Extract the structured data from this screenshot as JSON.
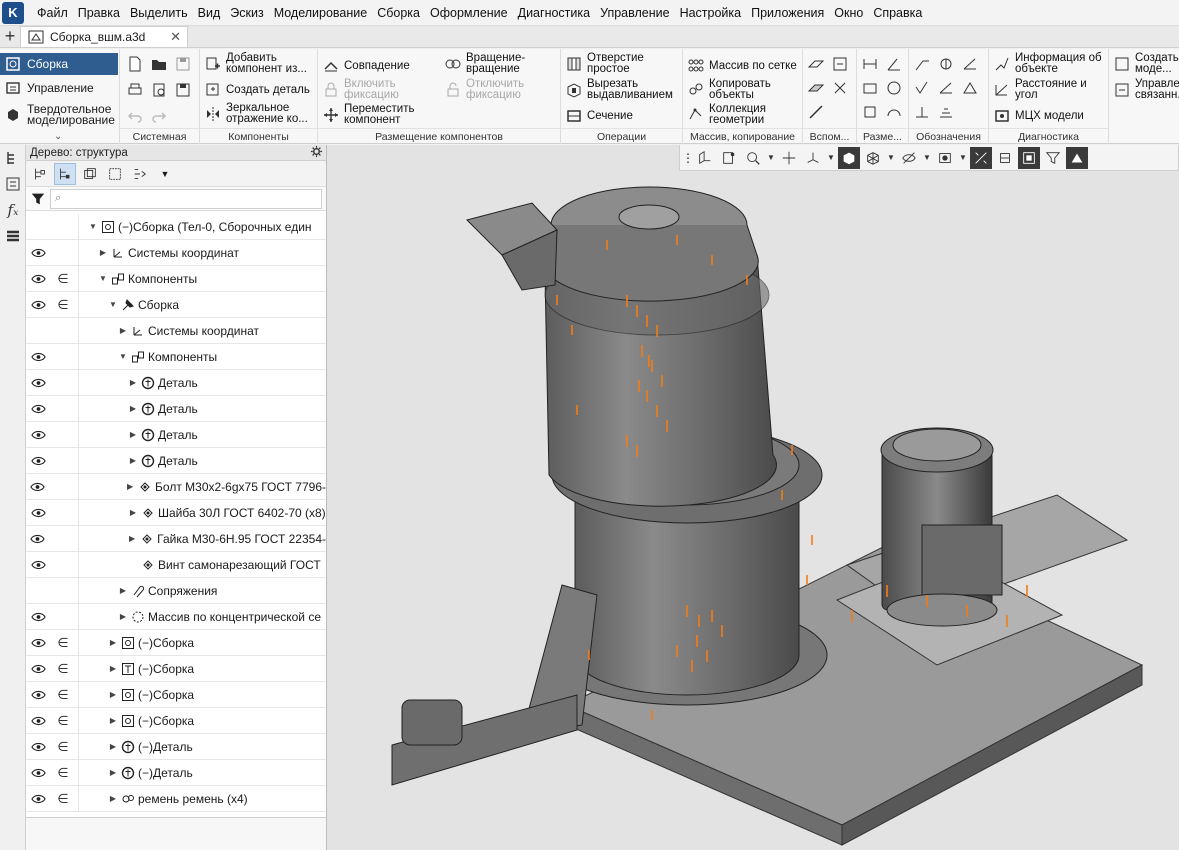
{
  "menu": {
    "items": [
      "Файл",
      "Правка",
      "Выделить",
      "Вид",
      "Эскиз",
      "Моделирование",
      "Сборка",
      "Оформление",
      "Диагностика",
      "Управление",
      "Настройка",
      "Приложения",
      "Окно",
      "Справка"
    ]
  },
  "tabs": {
    "doc_title": "Сборка_вшм.a3d"
  },
  "ribbon": {
    "modes": [
      "Сборка",
      "Управление",
      "Твердотельное моделирование"
    ],
    "groups": {
      "system": "Системная",
      "components": "Компоненты",
      "placement": "Размещение компонентов",
      "operations": "Операции",
      "array": "Массив, копирование",
      "aux": "Вспом...",
      "dims": "Разме...",
      "notation": "Обозначения",
      "diagnostics": "Диагностика"
    },
    "components": {
      "add": "Добавить компонент из...",
      "create_part": "Создать деталь",
      "mirror": "Зеркальное отражение ко..."
    },
    "placement": {
      "coincidence": "Совпадение",
      "rotation": "Вращение-вращение",
      "enable_fix": "Включить фиксацию",
      "disable_fix": "Отключить фиксацию",
      "move": "Переместить компонент"
    },
    "operations": {
      "hole": "Отверстие простое",
      "extrude_cut": "Вырезать выдавливанием",
      "section": "Сечение"
    },
    "array": {
      "grid": "Массив по сетке",
      "copy": "Копировать объекты",
      "collection": "Коллекция геометрии"
    },
    "diagnostics": {
      "info": "Информация об объекте",
      "distance": "Расстояние и угол",
      "mass": "МЦХ модели"
    },
    "right": {
      "create": "Создать по моде...",
      "manage": "Управле... связанн..."
    }
  },
  "tree": {
    "header": "Дерево: структура",
    "rows": [
      {
        "eye": false,
        "in": false,
        "level": 0,
        "expanded": true,
        "icon": "assembly",
        "label": "(−)Сборка (Тел-0, Сборочных един"
      },
      {
        "eye": true,
        "in": false,
        "level": 1,
        "expanded": false,
        "icon": "csys",
        "label": "Системы координат"
      },
      {
        "eye": true,
        "in": true,
        "level": 1,
        "expanded": true,
        "icon": "components",
        "label": "Компоненты"
      },
      {
        "eye": true,
        "in": true,
        "level": 2,
        "expanded": true,
        "icon": "assembly-pin",
        "label": "Сборка"
      },
      {
        "eye": false,
        "in": false,
        "level": 3,
        "expanded": false,
        "icon": "csys",
        "label": "Системы координат"
      },
      {
        "eye": true,
        "in": false,
        "level": 3,
        "expanded": true,
        "icon": "components",
        "label": "Компоненты"
      },
      {
        "eye": true,
        "in": false,
        "level": 4,
        "expanded": false,
        "icon": "part",
        "label": "Деталь"
      },
      {
        "eye": true,
        "in": false,
        "level": 4,
        "expanded": false,
        "icon": "part",
        "label": "Деталь"
      },
      {
        "eye": true,
        "in": false,
        "level": 4,
        "expanded": false,
        "icon": "part",
        "label": "Деталь"
      },
      {
        "eye": true,
        "in": false,
        "level": 4,
        "expanded": false,
        "icon": "part",
        "label": "Деталь"
      },
      {
        "eye": true,
        "in": false,
        "level": 4,
        "expanded": false,
        "icon": "fastener",
        "label": "Болт М30х2-6gх75 ГОСТ 7796-"
      },
      {
        "eye": true,
        "in": false,
        "level": 4,
        "expanded": false,
        "icon": "fastener",
        "label": "Шайба 30Л ГОСТ 6402-70 (х8)"
      },
      {
        "eye": true,
        "in": false,
        "level": 4,
        "expanded": false,
        "icon": "fastener",
        "label": "Гайка М30-6Н.95 ГОСТ 22354-"
      },
      {
        "eye": true,
        "in": false,
        "level": 4,
        "expanded": null,
        "icon": "fastener",
        "label": "Винт самонарезающий ГОСТ"
      },
      {
        "eye": false,
        "in": false,
        "level": 3,
        "expanded": false,
        "icon": "mate",
        "label": "Сопряжения"
      },
      {
        "eye": true,
        "in": false,
        "level": 3,
        "expanded": false,
        "icon": "pattern",
        "label": "Массив по концентрической се"
      },
      {
        "eye": true,
        "in": true,
        "level": 2,
        "expanded": false,
        "icon": "assembly",
        "label": "(−)Сборка"
      },
      {
        "eye": true,
        "in": true,
        "level": 2,
        "expanded": false,
        "icon": "assembly-t",
        "label": "(−)Сборка"
      },
      {
        "eye": true,
        "in": true,
        "level": 2,
        "expanded": false,
        "icon": "assembly",
        "label": "(−)Сборка"
      },
      {
        "eye": true,
        "in": true,
        "level": 2,
        "expanded": false,
        "icon": "assembly",
        "label": "(−)Сборка"
      },
      {
        "eye": true,
        "in": true,
        "level": 2,
        "expanded": false,
        "icon": "part",
        "label": "(−)Деталь"
      },
      {
        "eye": true,
        "in": true,
        "level": 2,
        "expanded": false,
        "icon": "part",
        "label": "(−)Деталь"
      },
      {
        "eye": true,
        "in": true,
        "level": 2,
        "expanded": false,
        "icon": "belt",
        "label": "ремень ремень (х4)"
      }
    ]
  },
  "colors": {
    "accent": "#2f5d8f",
    "model_gray": "#6b6b6b",
    "highlight_orange": "#f07d1a",
    "viewport_bg": "#e3e3e3"
  }
}
